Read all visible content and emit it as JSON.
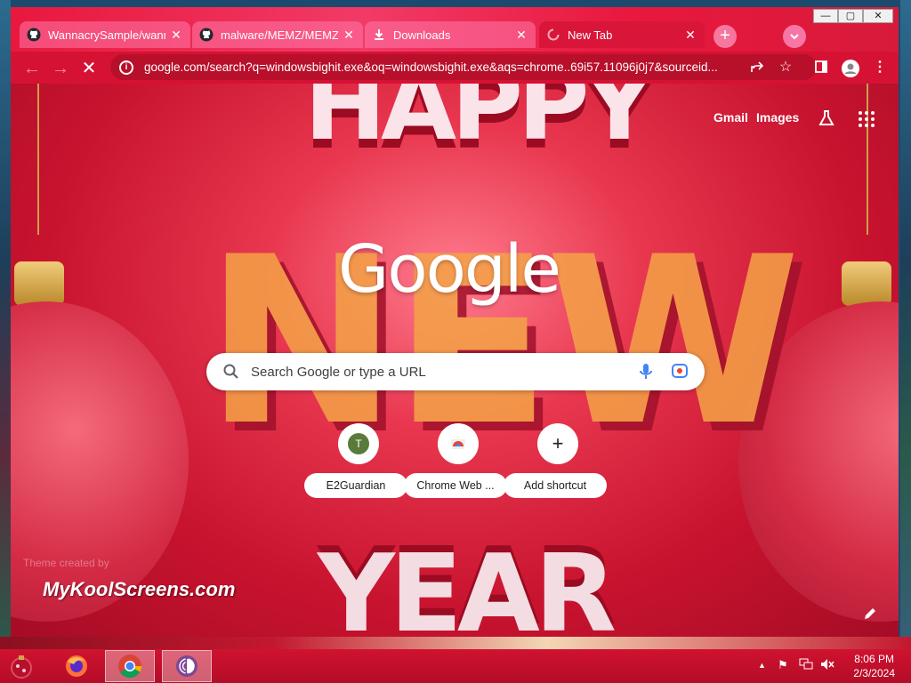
{
  "browser": {
    "tabs": [
      {
        "title": "WannacrySample/wann...",
        "icon": "github-icon",
        "active": false
      },
      {
        "title": "malware/MEMZ/MEMZ...",
        "icon": "github-icon",
        "active": false
      },
      {
        "title": "Downloads",
        "icon": "download-icon",
        "active": false
      },
      {
        "title": "New Tab",
        "icon": "loading-icon",
        "active": true
      }
    ],
    "url": "google.com/search?q=windowsbighit.exe&oq=windowsbighit.exe&aqs=chrome..69i57.11096j0j7&sourceid..."
  },
  "ntp": {
    "top_links": {
      "gmail": "Gmail",
      "images": "Images"
    },
    "logo": "Google",
    "search_placeholder": "Search Google or type a URL",
    "shortcuts": [
      {
        "name": "E2Guardian",
        "icon": "T"
      },
      {
        "name": "Chrome Web ...",
        "icon": "chrome-webstore-icon"
      },
      {
        "name": "Add shortcut",
        "icon": "+"
      }
    ],
    "theme_credit": "Theme created by",
    "watermark": "MyKoolScreens.com",
    "background_letters": {
      "top": "HAPPY",
      "middle": "NEW",
      "bottom": "YEAR"
    }
  },
  "taskbar": {
    "apps": [
      "start-orb-icon",
      "firefox-icon",
      "chrome-icon",
      "tor-icon"
    ],
    "time": "8:06 PM",
    "date": "2/3/2024"
  },
  "colors": {
    "accent": "#d61234",
    "tab_inactive": "#f27aa8",
    "background": "#c8132f"
  }
}
